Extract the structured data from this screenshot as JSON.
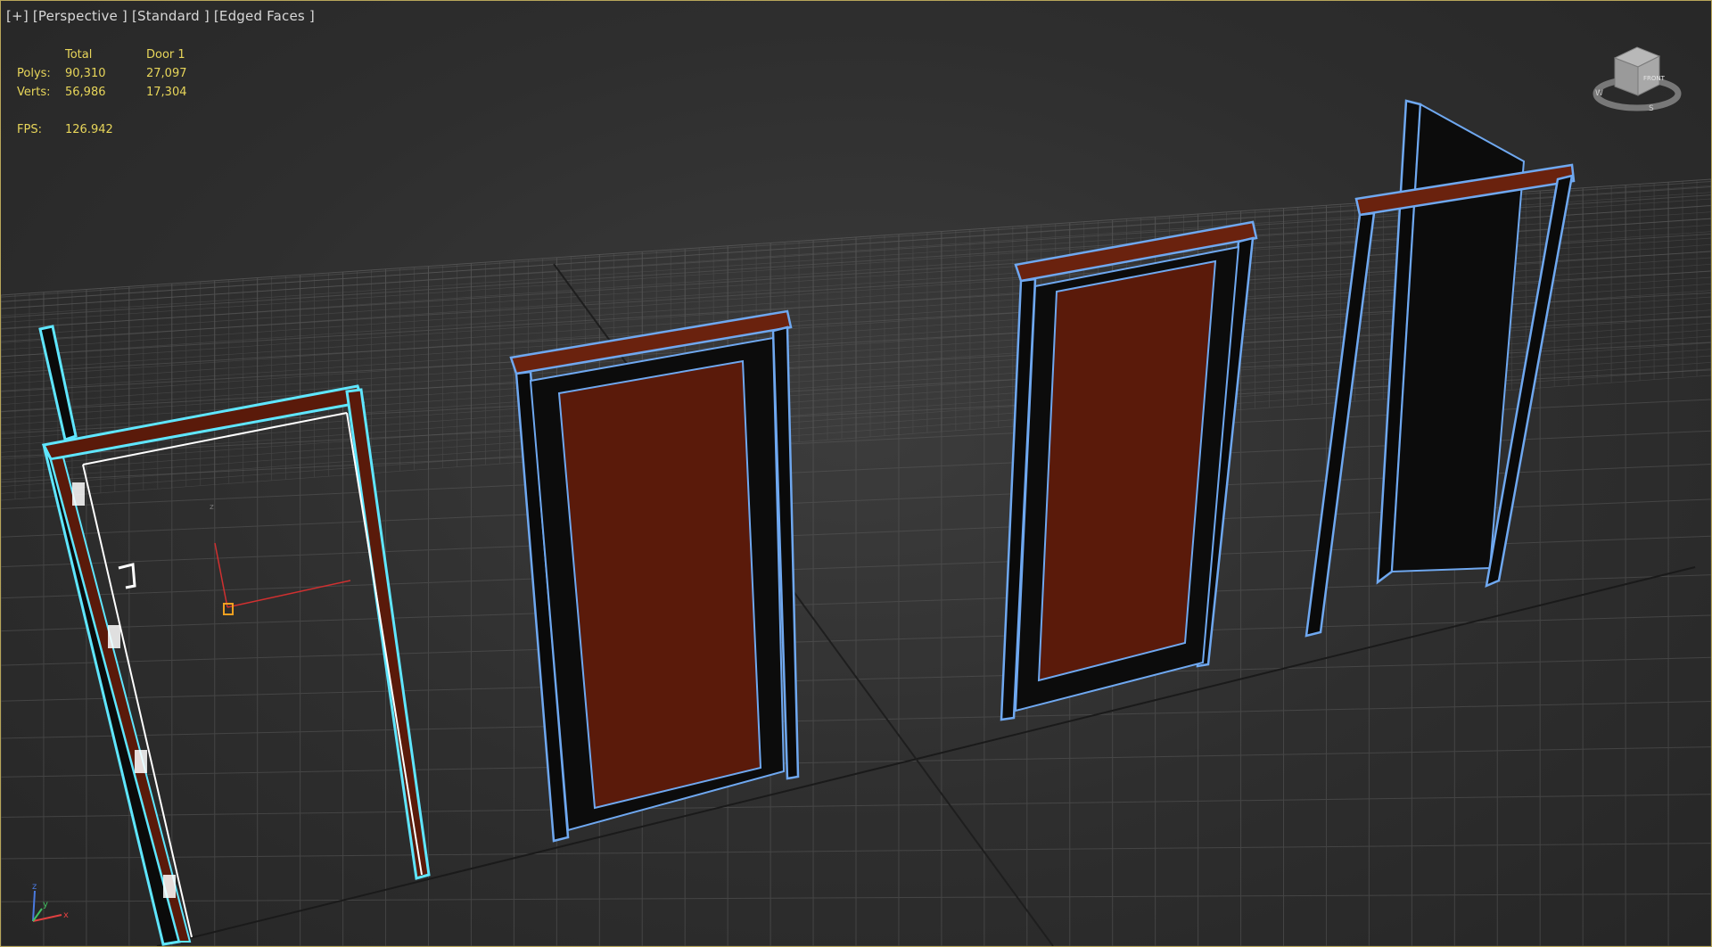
{
  "viewport": {
    "label_plus": "[+]",
    "label_view": "[Perspective ]",
    "label_shading": "[Standard ]",
    "label_mode": "[Edged Faces ]"
  },
  "stats": {
    "col_total": "Total",
    "col_object": "Door 1",
    "polys_label": "Polys:",
    "polys_total": "90,310",
    "polys_object": "27,097",
    "verts_label": "Verts:",
    "verts_total": "56,986",
    "verts_object": "17,304",
    "fps_label": "FPS:",
    "fps_value": "126.942"
  },
  "viewcube": {
    "face_label": "FRONT",
    "compass_w": "W",
    "compass_s": "S"
  },
  "axis_gizmo": {
    "z": "z",
    "y": "y",
    "x": "x"
  },
  "colors": {
    "wood": "#5a1a0a",
    "wood_light": "#7a2a12",
    "edge": "#6fa8f0",
    "selection": "#5fe6ff",
    "stats_text": "#e8d65a",
    "viewport_border": "#b8a65a"
  },
  "icons": [
    "viewcube-icon",
    "axis-tripod-icon",
    "pivot-gizmo-icon"
  ]
}
